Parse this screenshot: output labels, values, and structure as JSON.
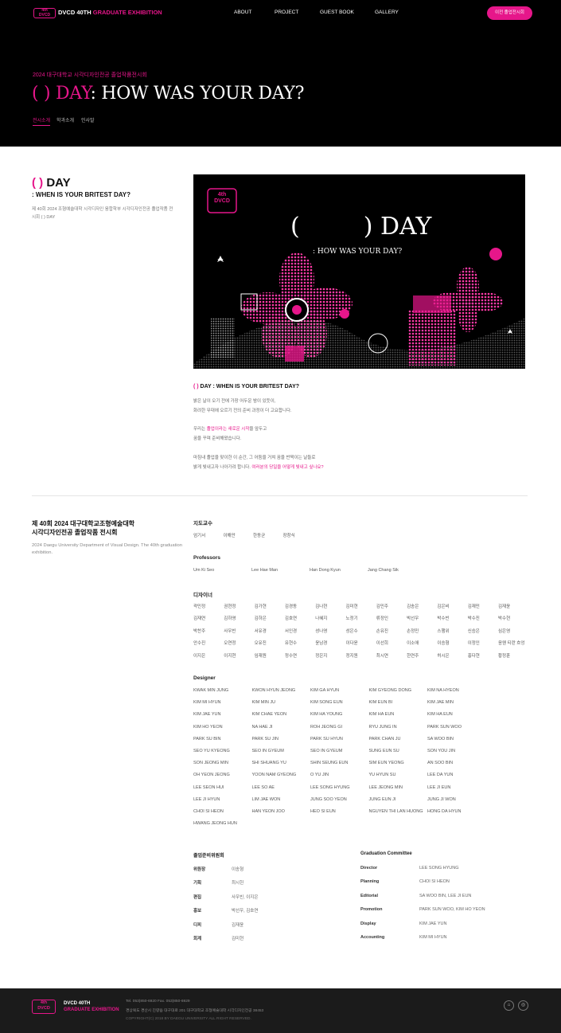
{
  "nav": {
    "logo_line1": "4th",
    "logo_line2": "DVCD",
    "brand_main": "DVCD 40TH ",
    "brand_accent": "GRADUATE EXHIBITION",
    "items": [
      "ABOUT",
      "PROJECT",
      "GUEST BOOK",
      "GALLERY"
    ],
    "pill": "이전 졸업전시회"
  },
  "hero": {
    "subtitle": "2024 대구대학교 시각디자인전공 졸업작품전시회",
    "title_accent": "(      ) DAY",
    "title_rest": ": HOW WAS YOUR DAY?",
    "tabs": [
      "전시소개",
      "학과소개",
      "인사말"
    ]
  },
  "intro": {
    "day_accent": "(    )",
    "day_rest": " DAY",
    "question": ": WHEN IS YOUR BRITEST DAY?",
    "desc": "제 40회 2024 조형예술대학 시각디자인 융합학부 시각디자인전공 졸업작품 전시회 (    ) DAY"
  },
  "poster": {
    "logo_line1": "4th",
    "logo_line2": "DVCD",
    "title_open": "(",
    "title_close": ") DAY",
    "subtitle": ": HOW WAS YOUR DAY?"
  },
  "article": {
    "head_accent": "(    )",
    "head_rest": " DAY : WHEN IS YOUR BRITEST DAY?",
    "p1_l1": "밝은 날이 오기 전에 가장 어두운 밤이 있듯이,",
    "p1_l2": "화려한 무대에 오르기 전의 준비 과정이 더 고요합니다.",
    "p2_pre": "우리는 ",
    "p2_accent": "졸업이라는 새로운 시작",
    "p2_post": "을 앞두고",
    "p2_l2": "꿈을 꾸며 준비해왔습니다.",
    "p3_l1": "마침내 졸업을 맞이한 이 순간, 그 어둠을 거쳐 꿈을 반짝이는 날들로",
    "p3_l2_pre": "밝게 빛내고자 나아가려 합니다. ",
    "p3_l2_accent": "여러분의 당일을 어떻게 빛내고 싶나요?"
  },
  "credits": {
    "title_l1": "제 40회 2024 대구대학교조형예술대학",
    "title_l2": "시각디자인전공 졸업작품 전시회",
    "english": "2024 Daegu University Department of Visual Design. The 40th graduation exhibition.",
    "professors_kr_label": "지도교수",
    "professors_kr": [
      "엄기서",
      "이해만",
      "한동균",
      "장창식"
    ],
    "professors_en_label": "Professors",
    "professors_en": [
      "Um Ki Seo",
      "Lee Hae Man",
      "Han Dong Kyun",
      "Jang Chang Sik"
    ],
    "designers_kr_label": "디자이너",
    "designers_kr": [
      "곽민정",
      "권현정",
      "김가현",
      "김경동",
      "김나현",
      "김미현",
      "김민주",
      "김송은",
      "김은비",
      "김재민",
      "김재윤",
      "김재연",
      "김하영",
      "김하은",
      "김호연",
      "나혜지",
      "노정기",
      "류정인",
      "박선우",
      "박수빈",
      "박수진",
      "박수현",
      "박찬주",
      "사우빈",
      "서유경",
      "서인경",
      "성나영",
      "성은수",
      "손유진",
      "손정민",
      "스행위",
      "신승은",
      "심은영",
      "안수진",
      "오연정",
      "오유진",
      "유현수",
      "윤남경",
      "이다윤",
      "이선희",
      "이소애",
      "이승형",
      "이정인",
      "응웬 티란 흐엉",
      "이지은",
      "이지현",
      "임재원",
      "정수연",
      "정은지",
      "정지원",
      "최시연",
      "한연주",
      "허시은",
      "홍다현",
      "황정훈"
    ],
    "designers_en_label": "Designer",
    "designers_en": [
      "KWAK MIN JUNG",
      "KWON HYUN JEONG",
      "KIM GA HYUN",
      "KIM GYEONG DONG",
      "KIM NA HYEON",
      "KIM MI HYUN",
      "KIM MIN JU",
      "KIM SONG EUN",
      "KIM EUN BI",
      "KIM JAE MIN",
      "KIM JAE YUN",
      "KIM CHAE YEON",
      "KIM HA YOUNG",
      "KIM HA EUN",
      "KIM HA EUN",
      "KIM HO YEON",
      "NA HAE JI",
      "ROH JEONG GI",
      "RYU JUNG IN",
      "PARK SUN WOO",
      "PARK SU BIN",
      "PARK SU JIN",
      "PARK SU HYUN",
      "PARK CHAN JU",
      "SA WOO BIN",
      "SEO YU KYEONG",
      "SEO IN GYEUM",
      "SEO IN GYEUM",
      "SUNG EUN SU",
      "SON YOU JIN",
      "SON JEONG MIN",
      "SHI SHUANG YU",
      "SHIN SEUNG EUN",
      "SIM EUN YEONG",
      "AN SOO BIN",
      "OH YEON JEONG",
      "YOON NAM GYEONG",
      "O YU JIN",
      "YU HYUN SU",
      "LEE DA YUN",
      "LEE SEON HUI",
      "LEE SO AE",
      "LEE SONG HYUNG",
      "LEE JEONG MIN",
      "LEE JI EUN",
      "LEE JI HYUN",
      "LIM JAE WON",
      "JUNG SOO YEON",
      "JUNG EUN JI",
      "JUNG JI WON",
      "CHOI SI HEON",
      "HAN YEON JOO",
      "HEO SI EUN",
      "NGUYEN THI LAN HUONG",
      "HONG DA HYUN",
      "HWANG JEONG HUN"
    ],
    "committee_kr_label": "졸업준비위원회",
    "committee_kr": [
      {
        "role": "위원장",
        "name": "이송형"
      },
      {
        "role": "기획",
        "name": "최시헌"
      },
      {
        "role": "편집",
        "name": "사우빈, 이지은"
      },
      {
        "role": "홍보",
        "name": "박선우, 김호연"
      },
      {
        "role": "디피",
        "name": "김재윤"
      },
      {
        "role": "회계",
        "name": "김미현"
      }
    ],
    "committee_en_label": "Graduation Committee",
    "committee_en": [
      {
        "role": "Director",
        "name": "LEE SONG HYUNG"
      },
      {
        "role": "Planning",
        "name": "CHOI SI HEON"
      },
      {
        "role": "Editorial",
        "name": "SA WOO BIN, LEE JI EUN"
      },
      {
        "role": "Promotion",
        "name": "PARK SUN WOO, KIM HO YEON"
      },
      {
        "role": "Display",
        "name": "KIM JAE YUN"
      },
      {
        "role": "Accounting",
        "name": "KIM MI HYUN"
      }
    ]
  },
  "footer": {
    "logo_line1": "4th",
    "logo_line2": "DVCD",
    "brand_l1": "DVCD 40TH",
    "brand_l2": "GRADUATE EXHIBITION",
    "tel": "Tel. 053)850-6920    Fax. 053)850-6929",
    "address": "경상북도 경산시 진량읍 대구대로 201 대구대학교 조형예술대학 시각디자인전공 38453",
    "copyright": "COPYRIGHT(C) 2018 BY DAEGU UNIVERSITY ALL RIGHT RESERVED.",
    "icons": [
      "home-icon",
      "instagram-icon"
    ]
  },
  "colors": {
    "accent": "#e6168a",
    "dark": "#000000",
    "footer": "#1b1b1b"
  }
}
